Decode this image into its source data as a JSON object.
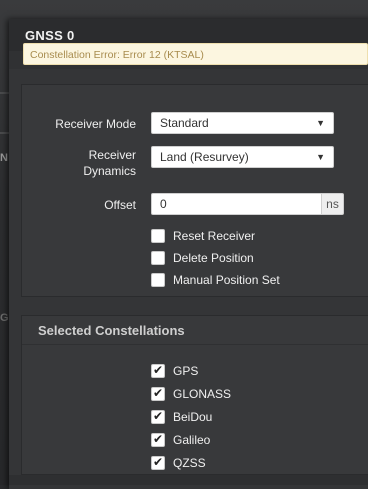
{
  "dialog": {
    "title": "GNSS 0",
    "alert": "Constellation Error: Error 12 (KTSAL)"
  },
  "background": {
    "marks": [
      "N",
      "G"
    ]
  },
  "form": {
    "receiver_mode": {
      "label": "Receiver Mode",
      "value": "Standard"
    },
    "receiver_dynamics": {
      "label_line1": "Receiver",
      "label_line2": "Dynamics",
      "value": "Land (Resurvey)"
    },
    "offset": {
      "label": "Offset",
      "value": "0",
      "unit": "ns"
    },
    "options": [
      {
        "label": "Reset Receiver",
        "checked": false
      },
      {
        "label": "Delete Position",
        "checked": false
      },
      {
        "label": "Manual Position Set",
        "checked": false
      }
    ]
  },
  "constellations": {
    "title": "Selected Constellations",
    "items": [
      {
        "label": "GPS",
        "checked": true
      },
      {
        "label": "GLONASS",
        "checked": true
      },
      {
        "label": "BeiDou",
        "checked": true
      },
      {
        "label": "Galileo",
        "checked": true
      },
      {
        "label": "QZSS",
        "checked": true
      }
    ]
  },
  "icons": {
    "caret": "chevron-down-icon",
    "check": "checkmark-icon"
  },
  "colors": {
    "dialog_bg": "#343537",
    "alert_bg": "#fcf6e0",
    "alert_text": "#a88c4e"
  }
}
